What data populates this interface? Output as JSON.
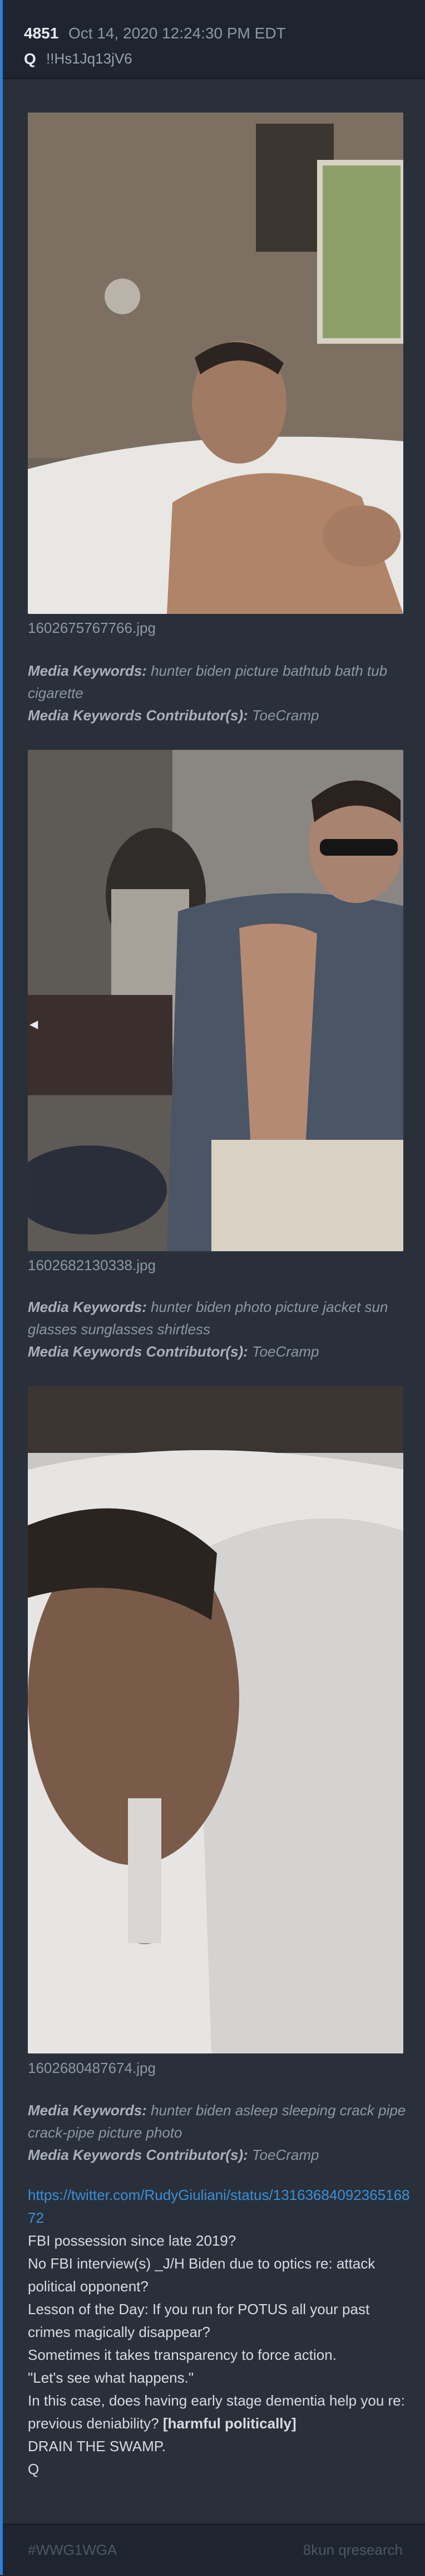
{
  "post": {
    "number": "4851",
    "date": "Oct 14, 2020 12:24:30 PM EDT",
    "author": "Q",
    "tripcode": "!!Hs1Jq13jV6"
  },
  "images": [
    {
      "filename": "1602675767766.jpg",
      "keywords_label": "Media Keywords:",
      "keywords": "hunter biden picture bathtub bath tub cigarette",
      "contributor_label": "Media Keywords Contributor(s):",
      "contributor": "ToeCramp"
    },
    {
      "filename": "1602682130338.jpg",
      "keywords_label": "Media Keywords:",
      "keywords": "hunter biden photo picture jacket sun glasses sunglasses shirtless",
      "contributor_label": "Media Keywords Contributor(s):",
      "contributor": "ToeCramp"
    },
    {
      "filename": "1602680487674.jpg",
      "keywords_label": "Media Keywords:",
      "keywords": "hunter biden asleep sleeping crack pipe crack-pipe picture photo",
      "contributor_label": "Media Keywords Contributor(s):",
      "contributor": "ToeCramp"
    }
  ],
  "body": {
    "link": "https://twitter.com/RudyGiuliani/status/1316368409236516872",
    "lines": [
      "FBI possession since late 2019?",
      "No FBI interview(s) _J/H Biden due to optics re: attack political opponent?",
      "Lesson of the Day: If you run for POTUS all your past crimes magically disappear?",
      "Sometimes it takes transparency to force action.",
      "\"Let's see what happens.\"",
      "In this case, does having early stage dementia help you re: previous deniability?"
    ],
    "bold_text": "[harmful politically]",
    "closing": "DRAIN THE SWAMP.",
    "signature": "Q"
  },
  "footer": {
    "hashtag": "#WWG1WGA",
    "source": "8kun qresearch"
  },
  "icons": {
    "nav": "left-arrow-icon"
  }
}
